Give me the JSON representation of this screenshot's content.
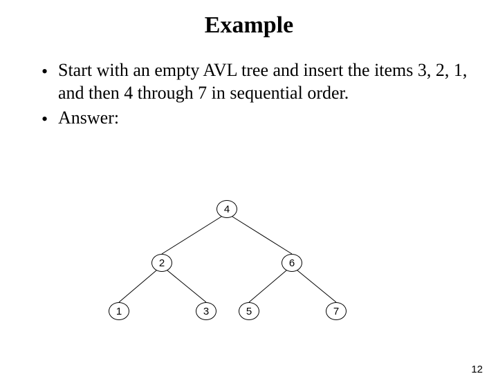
{
  "title": "Example",
  "bullets": [
    "Start with an empty AVL tree and insert the items 3, 2, 1, and then 4 through 7 in sequential order.",
    "Answer:"
  ],
  "tree": {
    "root": "4",
    "left": {
      "value": "2",
      "left": "1",
      "right": "3"
    },
    "right": {
      "value": "6",
      "left": "5",
      "right": "7"
    }
  },
  "page_number": "12"
}
